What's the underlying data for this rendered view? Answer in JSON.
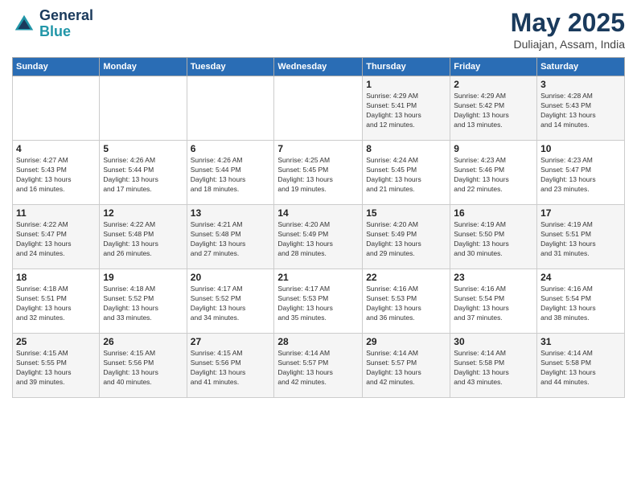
{
  "header": {
    "logo_line1": "General",
    "logo_line2": "Blue",
    "month_title": "May 2025",
    "location": "Duliajan, Assam, India"
  },
  "weekdays": [
    "Sunday",
    "Monday",
    "Tuesday",
    "Wednesday",
    "Thursday",
    "Friday",
    "Saturday"
  ],
  "weeks": [
    [
      {
        "day": "",
        "info": ""
      },
      {
        "day": "",
        "info": ""
      },
      {
        "day": "",
        "info": ""
      },
      {
        "day": "",
        "info": ""
      },
      {
        "day": "1",
        "info": "Sunrise: 4:29 AM\nSunset: 5:41 PM\nDaylight: 13 hours\nand 12 minutes."
      },
      {
        "day": "2",
        "info": "Sunrise: 4:29 AM\nSunset: 5:42 PM\nDaylight: 13 hours\nand 13 minutes."
      },
      {
        "day": "3",
        "info": "Sunrise: 4:28 AM\nSunset: 5:43 PM\nDaylight: 13 hours\nand 14 minutes."
      }
    ],
    [
      {
        "day": "4",
        "info": "Sunrise: 4:27 AM\nSunset: 5:43 PM\nDaylight: 13 hours\nand 16 minutes."
      },
      {
        "day": "5",
        "info": "Sunrise: 4:26 AM\nSunset: 5:44 PM\nDaylight: 13 hours\nand 17 minutes."
      },
      {
        "day": "6",
        "info": "Sunrise: 4:26 AM\nSunset: 5:44 PM\nDaylight: 13 hours\nand 18 minutes."
      },
      {
        "day": "7",
        "info": "Sunrise: 4:25 AM\nSunset: 5:45 PM\nDaylight: 13 hours\nand 19 minutes."
      },
      {
        "day": "8",
        "info": "Sunrise: 4:24 AM\nSunset: 5:45 PM\nDaylight: 13 hours\nand 21 minutes."
      },
      {
        "day": "9",
        "info": "Sunrise: 4:23 AM\nSunset: 5:46 PM\nDaylight: 13 hours\nand 22 minutes."
      },
      {
        "day": "10",
        "info": "Sunrise: 4:23 AM\nSunset: 5:47 PM\nDaylight: 13 hours\nand 23 minutes."
      }
    ],
    [
      {
        "day": "11",
        "info": "Sunrise: 4:22 AM\nSunset: 5:47 PM\nDaylight: 13 hours\nand 24 minutes."
      },
      {
        "day": "12",
        "info": "Sunrise: 4:22 AM\nSunset: 5:48 PM\nDaylight: 13 hours\nand 26 minutes."
      },
      {
        "day": "13",
        "info": "Sunrise: 4:21 AM\nSunset: 5:48 PM\nDaylight: 13 hours\nand 27 minutes."
      },
      {
        "day": "14",
        "info": "Sunrise: 4:20 AM\nSunset: 5:49 PM\nDaylight: 13 hours\nand 28 minutes."
      },
      {
        "day": "15",
        "info": "Sunrise: 4:20 AM\nSunset: 5:49 PM\nDaylight: 13 hours\nand 29 minutes."
      },
      {
        "day": "16",
        "info": "Sunrise: 4:19 AM\nSunset: 5:50 PM\nDaylight: 13 hours\nand 30 minutes."
      },
      {
        "day": "17",
        "info": "Sunrise: 4:19 AM\nSunset: 5:51 PM\nDaylight: 13 hours\nand 31 minutes."
      }
    ],
    [
      {
        "day": "18",
        "info": "Sunrise: 4:18 AM\nSunset: 5:51 PM\nDaylight: 13 hours\nand 32 minutes."
      },
      {
        "day": "19",
        "info": "Sunrise: 4:18 AM\nSunset: 5:52 PM\nDaylight: 13 hours\nand 33 minutes."
      },
      {
        "day": "20",
        "info": "Sunrise: 4:17 AM\nSunset: 5:52 PM\nDaylight: 13 hours\nand 34 minutes."
      },
      {
        "day": "21",
        "info": "Sunrise: 4:17 AM\nSunset: 5:53 PM\nDaylight: 13 hours\nand 35 minutes."
      },
      {
        "day": "22",
        "info": "Sunrise: 4:16 AM\nSunset: 5:53 PM\nDaylight: 13 hours\nand 36 minutes."
      },
      {
        "day": "23",
        "info": "Sunrise: 4:16 AM\nSunset: 5:54 PM\nDaylight: 13 hours\nand 37 minutes."
      },
      {
        "day": "24",
        "info": "Sunrise: 4:16 AM\nSunset: 5:54 PM\nDaylight: 13 hours\nand 38 minutes."
      }
    ],
    [
      {
        "day": "25",
        "info": "Sunrise: 4:15 AM\nSunset: 5:55 PM\nDaylight: 13 hours\nand 39 minutes."
      },
      {
        "day": "26",
        "info": "Sunrise: 4:15 AM\nSunset: 5:56 PM\nDaylight: 13 hours\nand 40 minutes."
      },
      {
        "day": "27",
        "info": "Sunrise: 4:15 AM\nSunset: 5:56 PM\nDaylight: 13 hours\nand 41 minutes."
      },
      {
        "day": "28",
        "info": "Sunrise: 4:14 AM\nSunset: 5:57 PM\nDaylight: 13 hours\nand 42 minutes."
      },
      {
        "day": "29",
        "info": "Sunrise: 4:14 AM\nSunset: 5:57 PM\nDaylight: 13 hours\nand 42 minutes."
      },
      {
        "day": "30",
        "info": "Sunrise: 4:14 AM\nSunset: 5:58 PM\nDaylight: 13 hours\nand 43 minutes."
      },
      {
        "day": "31",
        "info": "Sunrise: 4:14 AM\nSunset: 5:58 PM\nDaylight: 13 hours\nand 44 minutes."
      }
    ]
  ]
}
